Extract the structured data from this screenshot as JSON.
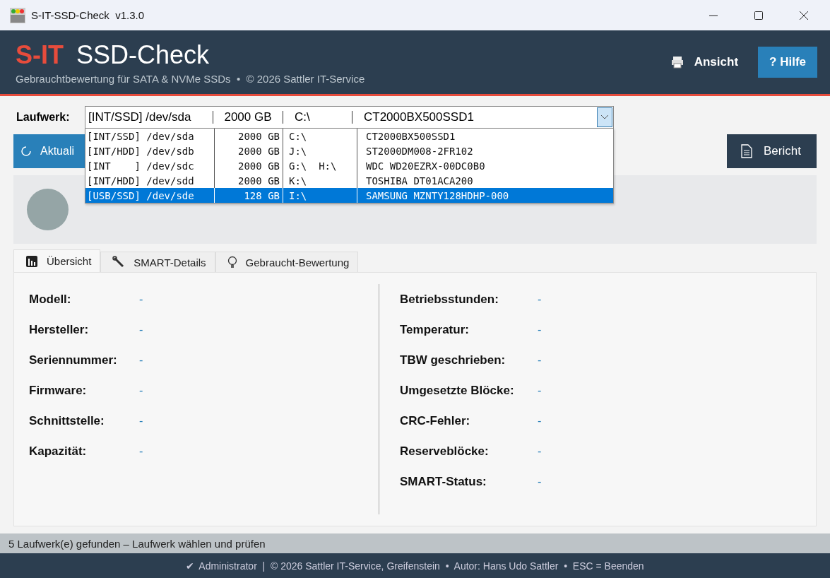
{
  "window": {
    "title": "S-IT-SSD-Check  v1.3.0"
  },
  "header": {
    "brand": "S-IT",
    "title": "SSD-Check",
    "subtitle": "Gebrauchtbewertung für SATA & NVMe SSDs  •  © 2026 Sattler IT-Service",
    "buttons": [
      {
        "label": "Ansicht",
        "kind": "menu"
      },
      {
        "label": "? Hilfe",
        "kind": "primary"
      }
    ]
  },
  "drive_select": {
    "label": "Laufwerk:",
    "value": [
      "[INT/SSD] /dev/sda",
      "2000 GB",
      "C:\\",
      "CT2000BX500SSD1"
    ],
    "expanded": true,
    "options": [
      {
        "type": "[INT/SSD]",
        "device": "/dev/sda",
        "size": "2000 GB",
        "letters": "C:\\",
        "model": "CT2000BX500SSD1",
        "selected": false
      },
      {
        "type": "[INT/HDD]",
        "device": "/dev/sdb",
        "size": "2000 GB",
        "letters": "J:\\",
        "model": "ST2000DM008-2FR102",
        "selected": false
      },
      {
        "type": "[INT    ]",
        "device": "/dev/sdc",
        "size": "2000 GB",
        "letters": "G:\\  H:\\",
        "model": "WDC WD20EZRX-00DC0B0",
        "selected": false
      },
      {
        "type": "[INT/HDD]",
        "device": "/dev/sdd",
        "size": "2000 GB",
        "letters": "K:\\",
        "model": "TOSHIBA DT01ACA200",
        "selected": false
      },
      {
        "type": "[USB/SSD]",
        "device": "/dev/sde",
        "size": "128 GB",
        "letters": "I:\\",
        "model": "SAMSUNG MZNTY128HDHP-000",
        "selected": true
      }
    ]
  },
  "actions": {
    "refresh": "Aktuali",
    "report": "Bericht"
  },
  "tabs": [
    {
      "label": "Übersicht",
      "kind": "chart",
      "selected": true
    },
    {
      "label": "SMART-Details",
      "kind": "wrench",
      "selected": false
    },
    {
      "label": "Gebraucht-Bewertung",
      "kind": "bulb",
      "selected": false
    }
  ],
  "overview": {
    "left": [
      {
        "label": "Modell:",
        "value": "-"
      },
      {
        "label": "Hersteller:",
        "value": "-"
      },
      {
        "label": "Seriennummer:",
        "value": "-"
      },
      {
        "label": "Firmware:",
        "value": "-"
      },
      {
        "label": "Schnittstelle:",
        "value": "-"
      },
      {
        "label": "Kapazität:",
        "value": "-"
      }
    ],
    "right": [
      {
        "label": "Betriebsstunden:",
        "value": "-"
      },
      {
        "label": "Temperatur:",
        "value": "-"
      },
      {
        "label": "TBW geschrieben:",
        "value": "-"
      },
      {
        "label": "Umgesetzte Blöcke:",
        "value": "-"
      },
      {
        "label": "CRC-Fehler:",
        "value": "-"
      },
      {
        "label": "Reserveblöcke:",
        "value": "-"
      },
      {
        "label": "SMART-Status:",
        "value": "-"
      }
    ]
  },
  "status_bar": "5 Laufwerk(e) gefunden – Laufwerk wählen und prüfen",
  "footer": {
    "check": "✔",
    "text": "Administrator  |  © 2026 Sattler IT-Service, Greifenstein  •  Autor: Hans Udo Sattler  •  ESC = Beenden"
  }
}
